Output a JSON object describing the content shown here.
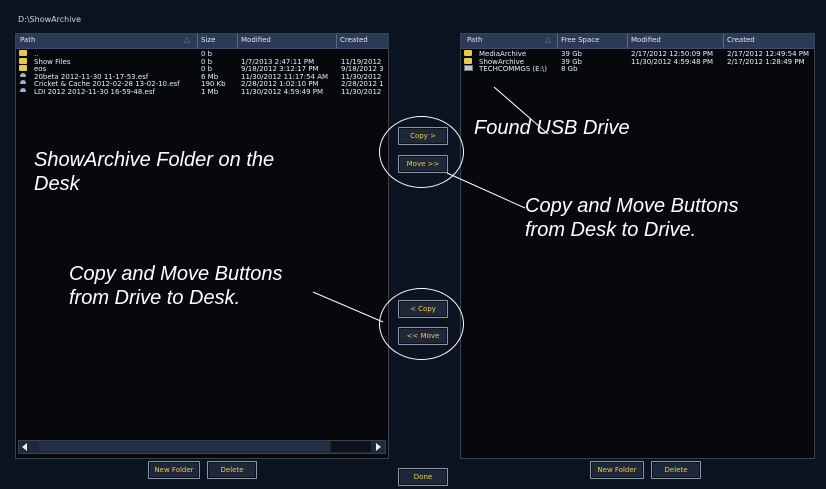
{
  "path": "D:\\ShowArchive",
  "left": {
    "columns": [
      "Path",
      "Size",
      "Modified",
      "Created"
    ],
    "rows": [
      {
        "icon": "folder",
        "name": "..",
        "size": "0 b",
        "modified": "",
        "created": ""
      },
      {
        "icon": "folder",
        "name": "Show Files",
        "size": "0 b",
        "modified": "1/7/2013 2:47:11 PM",
        "created": "11/19/2012"
      },
      {
        "icon": "folder",
        "name": "eos",
        "size": "0 b",
        "modified": "9/18/2012 3:12:17 PM",
        "created": "9/18/2012 3"
      },
      {
        "icon": "file",
        "name": "20beta 2012-11-30 11-17-53.esf",
        "size": "6 Mb",
        "modified": "11/30/2012 11:17:54 AM",
        "created": "11/30/2012"
      },
      {
        "icon": "file",
        "name": "Cricket & Cache 2012-02-28 13-02-10.esf",
        "size": "190 Kb",
        "modified": "2/28/2012 1:02:10 PM",
        "created": "2/28/2012 1"
      },
      {
        "icon": "file",
        "name": "LDI 2012 2012-11-30 16-59-48.esf",
        "size": "1 Mb",
        "modified": "11/30/2012 4:59:49 PM",
        "created": "11/30/2012"
      }
    ],
    "new_folder": "New Folder",
    "delete": "Delete"
  },
  "right": {
    "columns": [
      "Path",
      "Free Space",
      "Modified",
      "Created"
    ],
    "rows": [
      {
        "icon": "folder",
        "name": "MediaArchive",
        "size": "39 Gb",
        "modified": "2/17/2012 12:50:09 PM",
        "created": "2/17/2012 12:49:54 PM"
      },
      {
        "icon": "folder",
        "name": "ShowArchive",
        "size": "39 Gb",
        "modified": "11/30/2012 4:59:48 PM",
        "created": "2/17/2012 1:28:49 PM"
      },
      {
        "icon": "drive",
        "name": "TECHCOMMGS (E:\\)",
        "size": "8 Gb",
        "modified": "",
        "created": ""
      }
    ],
    "new_folder": "New Folder",
    "delete": "Delete"
  },
  "center": {
    "copy_right": "Copy >",
    "move_right": "Move >>",
    "copy_left": "< Copy",
    "move_left": "<< Move",
    "done": "Done"
  },
  "annotations": {
    "showarchive": "ShowArchive Folder on the Desk",
    "usb": "Found USB Drive",
    "desk_to_drive": "Copy and Move Buttons from Desk to Drive.",
    "drive_to_desk": "Copy and Move Buttons from Drive to Desk."
  }
}
